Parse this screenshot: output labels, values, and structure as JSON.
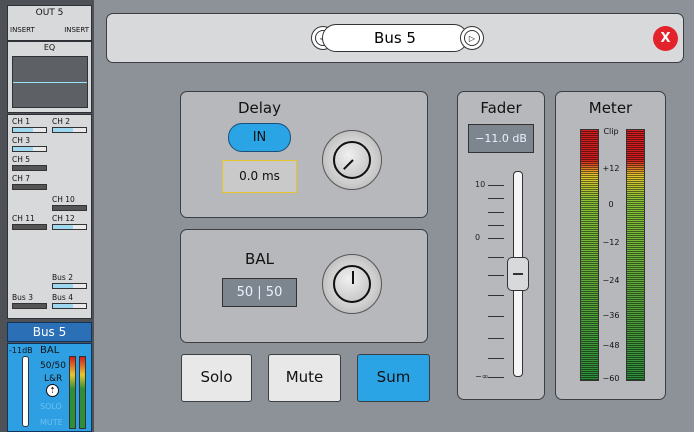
{
  "strip": {
    "out_title": "OUT 5",
    "insert_left": "INSERT",
    "insert_right": "INSERT",
    "eq_title": "EQ",
    "channels": [
      {
        "label": "CH 1",
        "state": "light"
      },
      {
        "label": "CH 2",
        "state": "light"
      },
      {
        "label": "CH 3",
        "state": "light"
      },
      {
        "label": "CH 5",
        "state": "dark"
      },
      {
        "label": "CH 7",
        "state": "dark"
      },
      {
        "label": "CH 10",
        "state": "dark"
      },
      {
        "label": "CH 11",
        "state": "dark"
      },
      {
        "label": "CH 12",
        "state": "light"
      },
      {
        "label": "Bus 2",
        "state": "light"
      },
      {
        "label": "Bus 3",
        "state": "dark"
      },
      {
        "label": "Bus 4",
        "state": "light"
      }
    ],
    "bus_tab": "Bus 5",
    "bus_level": "-11dB",
    "bus_bal_title": "BAL",
    "bus_bal_value": "50/50",
    "bus_lr": "L&R",
    "bus_solo": "SOLO",
    "bus_mute": "MUTE"
  },
  "header": {
    "title": "Bus 5",
    "prev_label": "◁",
    "next_label": "▷",
    "close_label": "X",
    "accent": "#e3222c"
  },
  "delay": {
    "title": "Delay",
    "in_label": "IN",
    "value": "0.0 ms"
  },
  "bal": {
    "title": "BAL",
    "value": "50 | 50"
  },
  "buttons": {
    "solo": "Solo",
    "mute": "Mute",
    "sum": "Sum",
    "sum_color": "#2aa4e4"
  },
  "fader": {
    "title": "Fader",
    "value": "−11.0 dB",
    "scale": [
      "10",
      "0",
      "−∞"
    ]
  },
  "meter": {
    "title": "Meter",
    "scale": [
      "Clip",
      "+12",
      "0",
      "−12",
      "−24",
      "−36",
      "−48",
      "−60"
    ]
  }
}
